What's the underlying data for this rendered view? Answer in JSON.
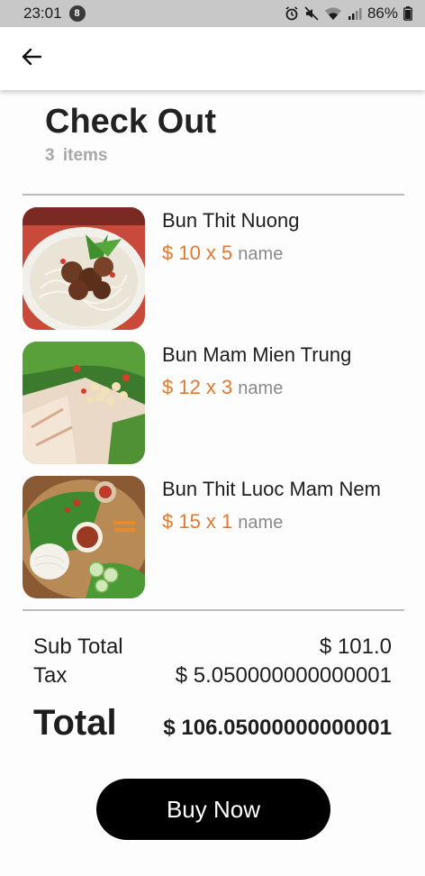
{
  "status_bar": {
    "time": "23:01",
    "notification_count": "8",
    "battery_percent": "86%",
    "icons": [
      "alarm-icon",
      "mute-icon",
      "wifi-icon",
      "signal-icon",
      "battery-icon"
    ]
  },
  "app_bar": {
    "back_icon": "arrow-left-icon"
  },
  "page": {
    "title": "Check Out",
    "items_count": "3 items"
  },
  "cart": {
    "items": [
      {
        "name": "Bun Thit Nuong",
        "price": "$ 10 x 5",
        "suffix": "name"
      },
      {
        "name": "Bun Mam Mien Trung",
        "price": "$ 12 x 3",
        "suffix": "name"
      },
      {
        "name": "Bun Thit Luoc Mam Nem",
        "price": "$ 15 x 1",
        "suffix": "name"
      }
    ]
  },
  "summary": {
    "subtotal_label": "Sub Total",
    "subtotal_value": "$ 101.0",
    "tax_label": "Tax",
    "tax_value": "$ 5.050000000000001",
    "total_label": "Total",
    "total_value": "$ 106.05000000000001"
  },
  "buy_button": {
    "label": "Buy Now"
  },
  "colors": {
    "accent_price": "#e07a2e",
    "button_bg": "#000000",
    "status_bar_bg": "#c8c8c8"
  }
}
